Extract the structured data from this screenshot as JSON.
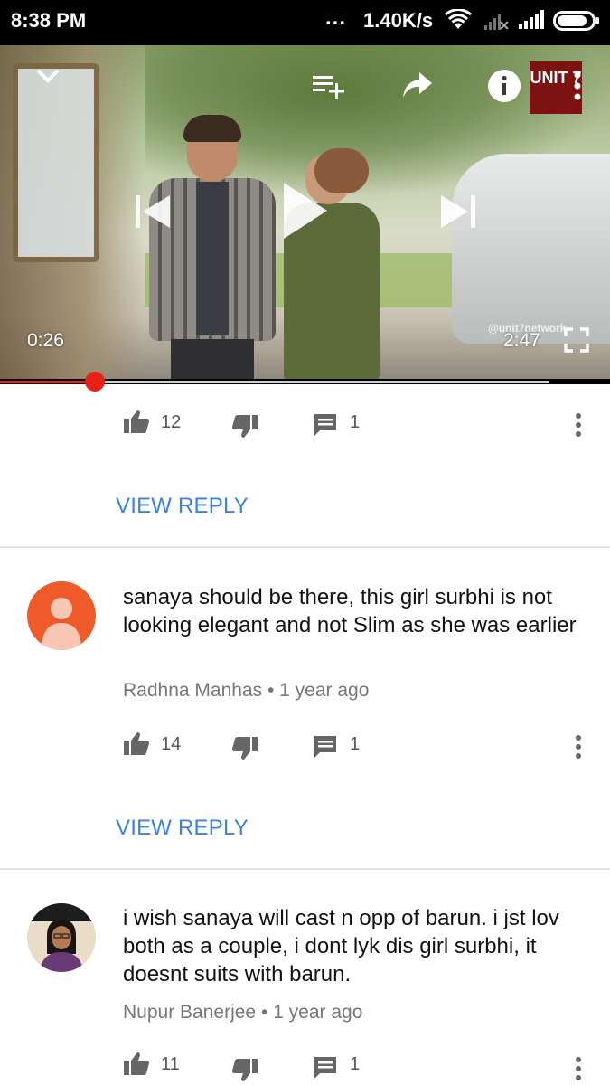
{
  "status_bar": {
    "time": "8:38 PM",
    "dots": "...",
    "network_speed": "1.40K/s",
    "icons": [
      "wifi-icon",
      "signal-none-icon",
      "signal-icon",
      "battery-icon"
    ]
  },
  "player": {
    "current_time": "0:26",
    "duration": "2:47",
    "watermark": "@unit7network",
    "channel_logo": "UNIT 7",
    "played_fraction": 0.156,
    "buffered_fraction": 0.9,
    "icons": [
      "chevron-down-icon",
      "add-to-playlist-icon",
      "share-icon",
      "info-icon",
      "more-vert-icon",
      "previous-icon",
      "play-icon",
      "next-icon",
      "fullscreen-icon"
    ]
  },
  "colors": {
    "accent_red": "#e62117",
    "link_blue": "#3b82e0",
    "avatar_orange": "#ef5a2a"
  },
  "comments": [
    {
      "likes": "12",
      "replies": "1",
      "view_reply": "VIEW REPLY"
    },
    {
      "text": "sanaya should be there, this girl surbhi is not looking elegant and not Slim as she was earlier",
      "author": "Radhna Manhas",
      "separator": "•",
      "age": "1 year ago",
      "likes": "14",
      "replies": "1",
      "view_reply": "VIEW REPLY"
    },
    {
      "text": "i wish  sanaya will cast n opp of barun. i jst lov both as a couple, i dont lyk dis girl surbhi, it doesnt suits with barun.",
      "author": "Nupur Banerjee",
      "separator": "•",
      "age": "1 year ago",
      "likes": "11",
      "replies": "1"
    }
  ]
}
